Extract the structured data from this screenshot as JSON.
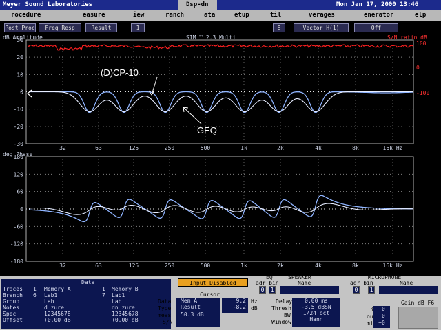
{
  "titlebar": {
    "app": "Meyer Sound Laboratories",
    "file": "Dsp-dn",
    "datetime": "Mon Jan 17, 2000 13:46"
  },
  "menu": [
    "rocedure",
    "easure",
    "iew",
    "ranch",
    "ata",
    "etup",
    "til",
    "verages",
    "enerator",
    "elp"
  ],
  "toolbar": {
    "post_proc": "Post Proc",
    "freq_resp": "Freq Resp",
    "result": "Result",
    "result_val": "1",
    "avg_count": "8",
    "vector": "Vector H(1)",
    "off": "Off"
  },
  "amp_plot": {
    "ylabel": "dB Amplitude",
    "subtitle": "SIM ™ 2.3 Multi",
    "right_label": "S/N ratio dB",
    "y_ticks": [
      "30",
      "20",
      "10",
      "0",
      "-10",
      "-20",
      "-30"
    ],
    "right_ticks": [
      "100",
      "0",
      "-100"
    ],
    "x_ticks": [
      "32",
      "63",
      "125",
      "250",
      "500",
      "1k",
      "2k",
      "4k",
      "8k",
      "16k Hz"
    ]
  },
  "phase_plot": {
    "ylabel": "deg Phase",
    "y_ticks": [
      "180",
      "120",
      "60",
      "0",
      "-60",
      "-120",
      "-180"
    ],
    "x_ticks": [
      "32",
      "63",
      "125",
      "250",
      "500",
      "1k",
      "2k",
      "4k",
      "8k",
      "16k Hz"
    ]
  },
  "annotations": {
    "cp10": "(D)CP-10",
    "geq": "GEQ"
  },
  "data_panel": {
    "title": "Data",
    "row_labels": [
      "Traces",
      "Branch",
      "Group",
      "Notes",
      "Spec",
      "Offset"
    ],
    "col_a": [
      "Memory A",
      "Lab1",
      "Lab",
      "d zure",
      "12345678",
      "+0.00 dB"
    ],
    "col_a_idx": [
      "",
      "1",
      "6",
      "",
      "",
      ""
    ],
    "col_b": [
      "Memory B",
      "Lab1",
      "Lab",
      "dn zure",
      "12345678",
      "+0.00 dB"
    ],
    "col_b_idx": [
      "",
      "1",
      "7",
      "",
      "",
      ""
    ]
  },
  "status": {
    "input_disabled": "Input Disabled"
  },
  "cursor_panel": {
    "title": "Cursor",
    "labels": [
      "Data",
      "Type",
      "meas",
      "S/N"
    ],
    "col1": [
      "Mem A",
      "Result",
      "50.3 dB"
    ],
    "col2": [
      "9.2",
      "-8.2"
    ],
    "units": [
      "Hz",
      "dB"
    ]
  },
  "eq_panel": {
    "title": "EQ",
    "sub": "adr bin",
    "val1": "0",
    "val2": "1"
  },
  "speaker_panel": {
    "title": "SPEAKER",
    "name_label": "Name"
  },
  "mic_panel": {
    "title": "MICROPHONE",
    "sub": "adr bin",
    "name_label": "Name",
    "val1": "0",
    "val2": "1"
  },
  "delay_panel": {
    "labels": [
      "Delay",
      "Thresh",
      "BW",
      "Window"
    ],
    "values": [
      "0.00 ms",
      "-3.5 dBSN",
      "1/24 oct",
      "Hann"
    ]
  },
  "gain_panel": {
    "title": "Gain dB F6",
    "labels": [
      "in",
      "out",
      "mic"
    ],
    "values": [
      "+0",
      "+0",
      "+0"
    ]
  },
  "colors": {
    "titlebar": "#1c2a8c",
    "trace_a": "#8fb4ff",
    "trace_b": "#e6ecff",
    "sn_trace": "#ff2020",
    "menu_bg": "#b8b8b8"
  }
}
